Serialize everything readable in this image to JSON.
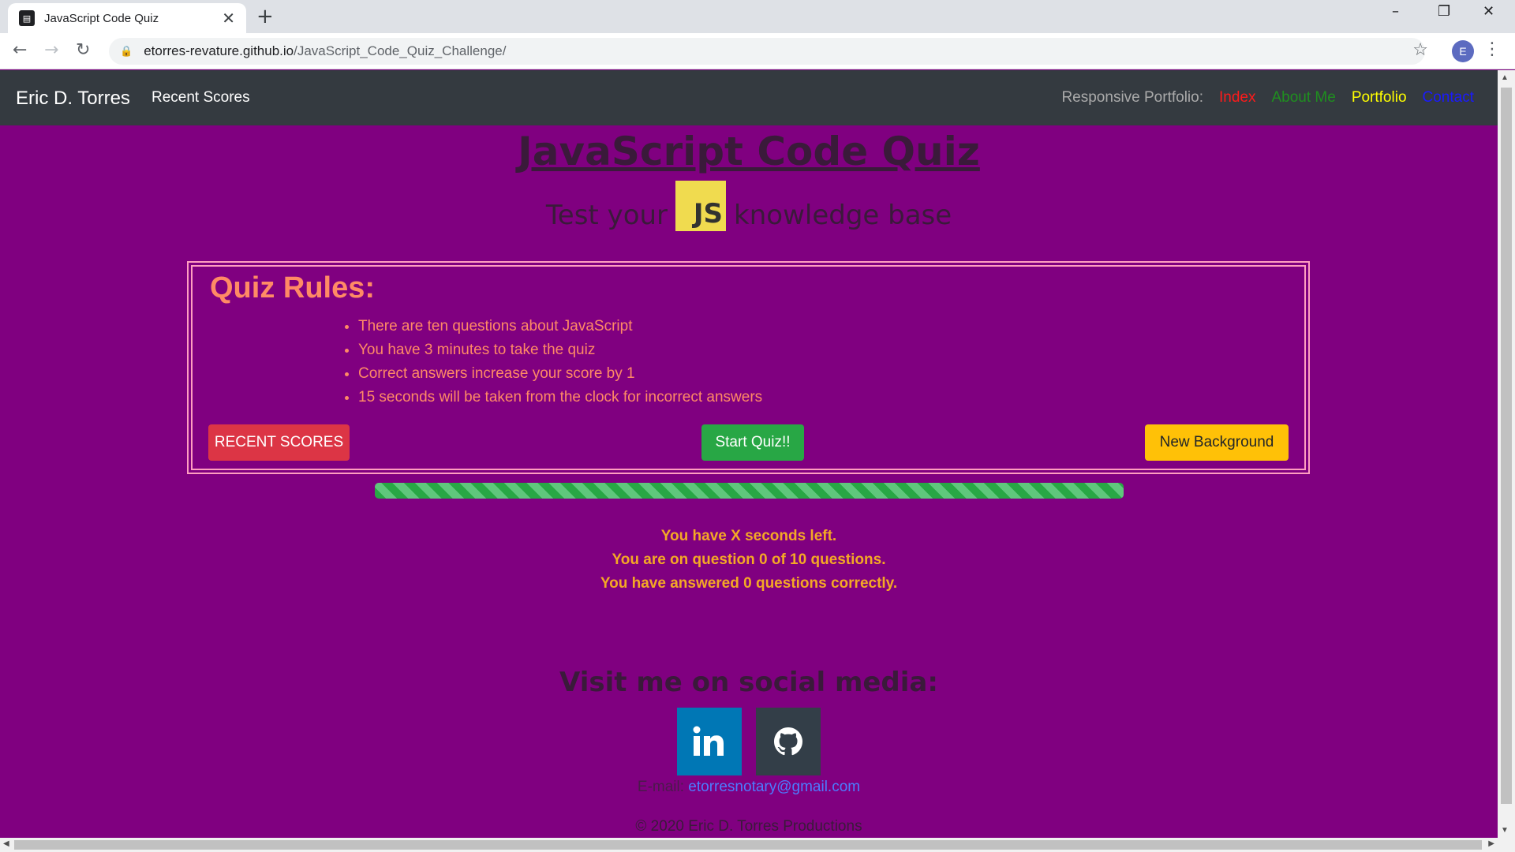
{
  "browser": {
    "tab_title": "JavaScript Code Quiz",
    "url_host": "etorres-revature.github.io",
    "url_path": "/JavaScript_Code_Quiz_Challenge/",
    "profile_initial": "E"
  },
  "navbar": {
    "brand": "Eric D. Torres",
    "recent_scores": "Recent Scores",
    "portfolio_label": "Responsive Portfolio:",
    "links": [
      {
        "label": "Index",
        "color": "#ff1a1a"
      },
      {
        "label": "About Me",
        "color": "#1f8f1f"
      },
      {
        "label": "Portfolio",
        "color": "#ffff00"
      },
      {
        "label": "Contact",
        "color": "#1a1aff"
      }
    ]
  },
  "header": {
    "title": "JavaScript Code Quiz",
    "subtitle_before": "Test your",
    "js_logo": "JS",
    "subtitle_after": "knowledge base"
  },
  "rules": {
    "title": "Quiz Rules:",
    "items": [
      "There are ten questions about JavaScript",
      "You have 3 minutes to take the quiz",
      "Correct answers increase your score by 1",
      "15 seconds will be taken from the clock for incorrect answers"
    ]
  },
  "buttons": {
    "recent_scores": "RECENT SCORES",
    "start_quiz": "Start Quiz!!",
    "new_background": "New Background"
  },
  "progress": {
    "percent": 100
  },
  "status": {
    "time_left": "You have X seconds left.",
    "question": "You are on question 0 of 10 questions.",
    "answered": "You have answered 0 questions correctly."
  },
  "footer": {
    "social_title": "Visit me on social media:",
    "email_label": "E-mail:",
    "email": "etorresnotary@gmail.com",
    "copyright": "© 2020 Eric D. Torres Productions"
  }
}
